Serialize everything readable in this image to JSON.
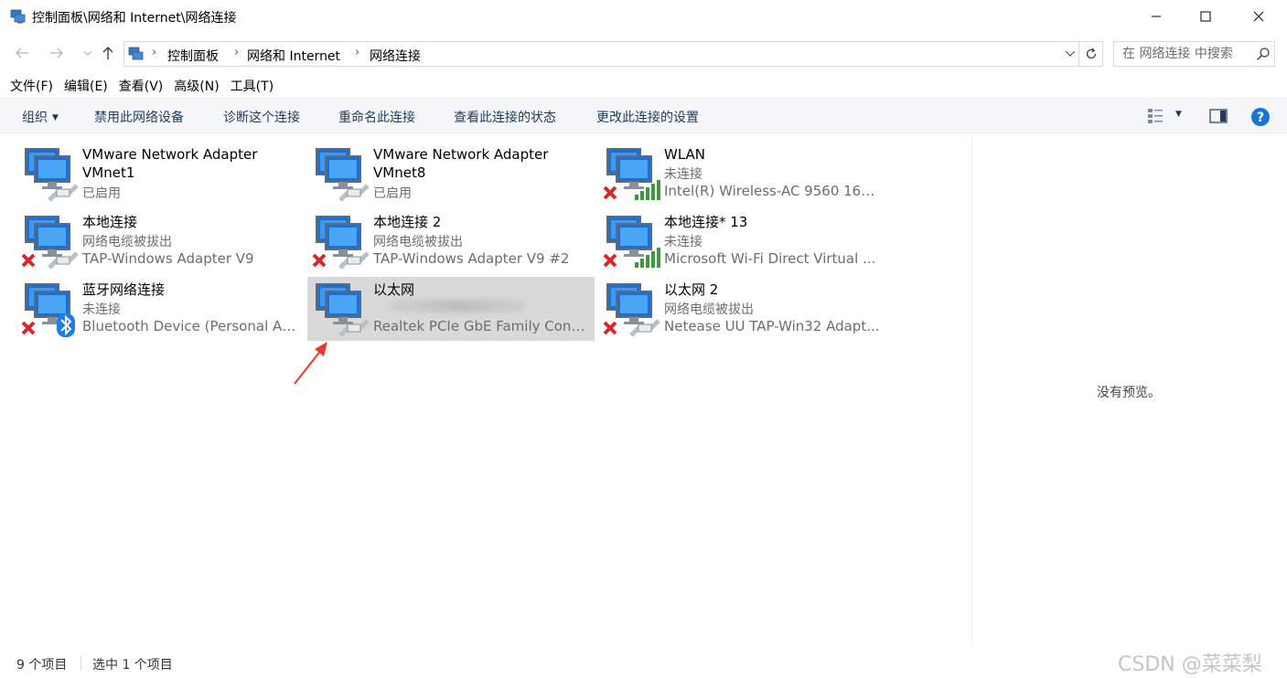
{
  "window": {
    "title": "控制面板\\网络和 Internet\\网络连接"
  },
  "address": {
    "crumbs": [
      "控制面板",
      "网络和 Internet",
      "网络连接"
    ],
    "search_placeholder": "在 网络连接 中搜索"
  },
  "menu": [
    "文件(F)",
    "编辑(E)",
    "查看(V)",
    "高级(N)",
    "工具(T)"
  ],
  "commands": {
    "organize": "组织",
    "disable": "禁用此网络设备",
    "diagnose": "诊断这个连接",
    "rename": "重命名此连接",
    "status": "查看此连接的状态",
    "settings": "更改此连接的设置"
  },
  "connections": [
    {
      "name": "VMware Network Adapter VMnet1",
      "status": "已启用",
      "device": "",
      "badge": "none",
      "overlay": "cable",
      "selected": false
    },
    {
      "name": "VMware Network Adapter VMnet8",
      "status": "已启用",
      "device": "",
      "badge": "none",
      "overlay": "cable",
      "selected": false
    },
    {
      "name": "WLAN",
      "status": "未连接",
      "device": "Intel(R) Wireless-AC 9560 160...",
      "badge": "x",
      "overlay": "signal",
      "selected": false
    },
    {
      "name": "本地连接",
      "status": "网络电缆被拔出",
      "device": "TAP-Windows Adapter V9",
      "badge": "x",
      "overlay": "cable",
      "selected": false
    },
    {
      "name": "本地连接 2",
      "status": "网络电缆被拔出",
      "device": "TAP-Windows Adapter V9 #2",
      "badge": "x",
      "overlay": "cable",
      "selected": false
    },
    {
      "name": "本地连接* 13",
      "status": "未连接",
      "device": "Microsoft Wi-Fi Direct Virtual ...",
      "badge": "x",
      "overlay": "signal",
      "selected": false
    },
    {
      "name": "蓝牙网络连接",
      "status": "未连接",
      "device": "Bluetooth Device (Personal Ar...",
      "badge": "x",
      "overlay": "bluetooth",
      "selected": false
    },
    {
      "name": "以太网",
      "status": "",
      "device": "Realtek PCIe GbE Family Contr...",
      "badge": "none",
      "overlay": "cable",
      "selected": true
    },
    {
      "name": "以太网 2",
      "status": "网络电缆被拔出",
      "device": "Netease UU TAP-Win32 Adapt...",
      "badge": "x",
      "overlay": "cable",
      "selected": false
    }
  ],
  "preview": {
    "message": "没有预览。"
  },
  "statusbar": {
    "count": "9 个项目",
    "selected": "选中 1 个项目"
  },
  "watermark": "CSDN @菜菜梨"
}
